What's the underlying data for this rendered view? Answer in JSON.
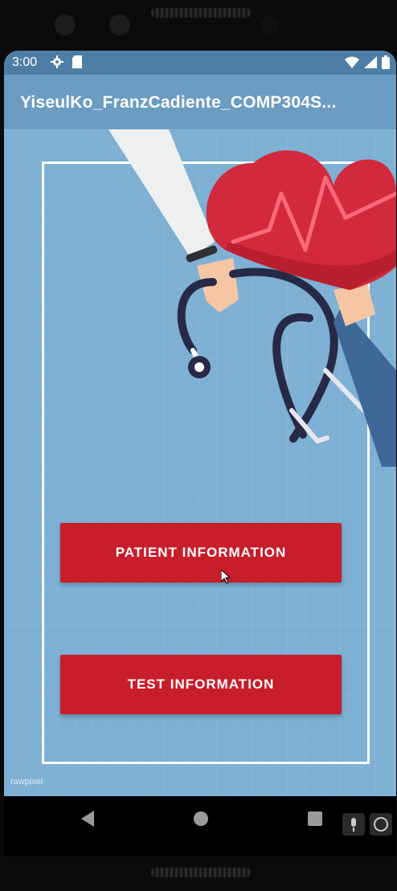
{
  "status": {
    "time": "3:00",
    "icons_left": [
      "gear-icon",
      "sd-card-icon"
    ],
    "icons_right": [
      "wifi-icon",
      "signal-icon",
      "battery-icon"
    ]
  },
  "appbar": {
    "title": "YiseulKo_FranzCadiente_COMP304S..."
  },
  "buttons": {
    "patient_label": "PATIENT INFORMATION",
    "test_label": "TEST INFORMATION"
  },
  "watermark": "rawpixel",
  "navigation": [
    "back-icon",
    "home-icon",
    "recent-apps-icon"
  ],
  "colors": {
    "status_bar": "#4e7ea5",
    "app_bar": "#6b9cc2",
    "background": "#7eb0d4",
    "button": "#c81d2a",
    "heart": "#d22a3c"
  }
}
